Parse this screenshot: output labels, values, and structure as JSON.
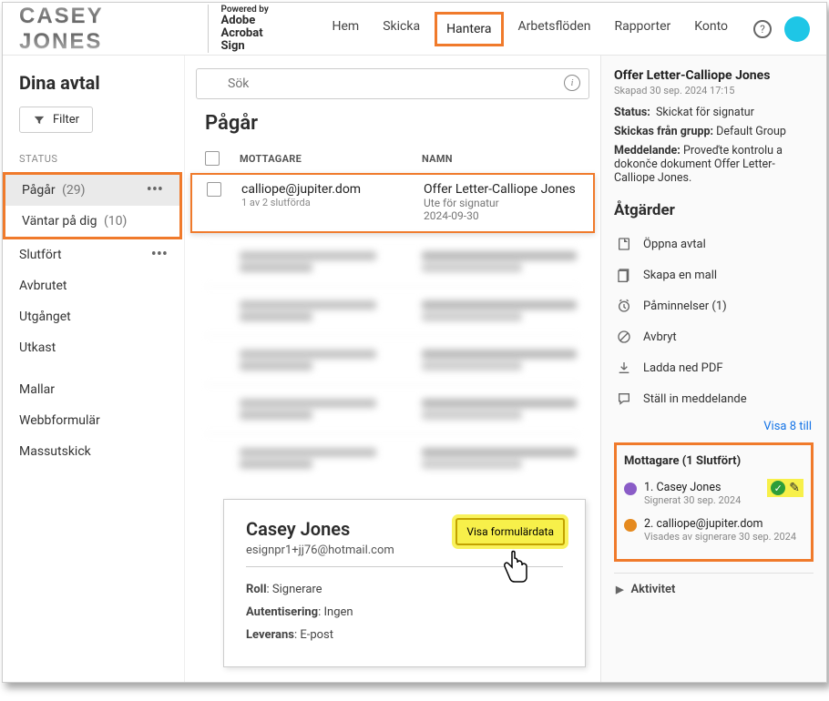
{
  "header": {
    "logo": "CASEY  JONES",
    "powered_label": "Powered by",
    "powered_brand": "Adobe\nAcrobat Sign",
    "nav": [
      "Hem",
      "Skicka",
      "Hantera",
      "Arbetsflöden",
      "Rapporter",
      "Konto"
    ],
    "active_nav_index": 2
  },
  "sidebar": {
    "title": "Dina avtal",
    "filter_label": "Filter",
    "status_label": "STATUS",
    "items": [
      {
        "label": "Pågår",
        "count": "(29)",
        "selected": true,
        "dots": true
      },
      {
        "label": "Väntar på dig",
        "count": "(10)"
      },
      {
        "label": "Slutfört",
        "dots": true
      },
      {
        "label": "Avbrutet"
      },
      {
        "label": "Utgånget"
      },
      {
        "label": "Utkast"
      }
    ],
    "other_label": "",
    "other_items": [
      {
        "label": "Mallar"
      },
      {
        "label": "Webbformulär"
      },
      {
        "label": "Massutskick"
      }
    ]
  },
  "main": {
    "search_placeholder": "Sök",
    "title": "Pågår",
    "col_recipient": "MOTTAGARE",
    "col_name": "NAMN",
    "row": {
      "recipient": "calliope@jupiter.dom",
      "progress": "1 av 2 slutförda",
      "name": "Offer Letter-Calliope Jones",
      "status": "Ute för signatur",
      "date": "2024-09-30"
    }
  },
  "detail_card": {
    "name": "Casey Jones",
    "email": "esignpr1+jj76@hotmail.com",
    "role_label": "Roll",
    "role_value": "Signerare",
    "auth_label": "Autentisering",
    "auth_value": "Ingen",
    "delivery_label": "Leverans",
    "delivery_value": "E-post",
    "button": "Visa formulärdata"
  },
  "rpanel": {
    "title": "Offer Letter-Calliope Jones",
    "created": "Skapad 30 sep. 2024 17:15",
    "status_label": "Status:",
    "status_value": "Skickat för signatur",
    "group_label": "Skickas från grupp:",
    "group_value": "Default Group",
    "message_label": "Meddelande:",
    "message_value": "Proveďte kontrolu a dokonče dokument Offer Letter-Calliope Jones.",
    "actions_head": "Åtgärder",
    "actions": [
      {
        "icon": "open",
        "label": "Öppna avtal"
      },
      {
        "icon": "template",
        "label": "Skapa en mall"
      },
      {
        "icon": "reminder",
        "label": "Påminnelser (1)"
      },
      {
        "icon": "cancel",
        "label": "Avbryt"
      },
      {
        "icon": "download",
        "label": "Ladda ned PDF"
      },
      {
        "icon": "note",
        "label": "Ställ in meddelande"
      }
    ],
    "show_more": "Visa 8 till",
    "recipients_head": "Mottagare (1 Slutfört)",
    "recipients": [
      {
        "num": "1.",
        "name": "Casey Jones",
        "sub": "Signerat 30 sep. 2024",
        "dot": "purple",
        "done": true
      },
      {
        "num": "2.",
        "name": "calliope@jupiter.dom",
        "sub": "Visades av signerare 30 sep. 2024",
        "dot": "orange"
      }
    ],
    "activity": "Aktivitet"
  }
}
